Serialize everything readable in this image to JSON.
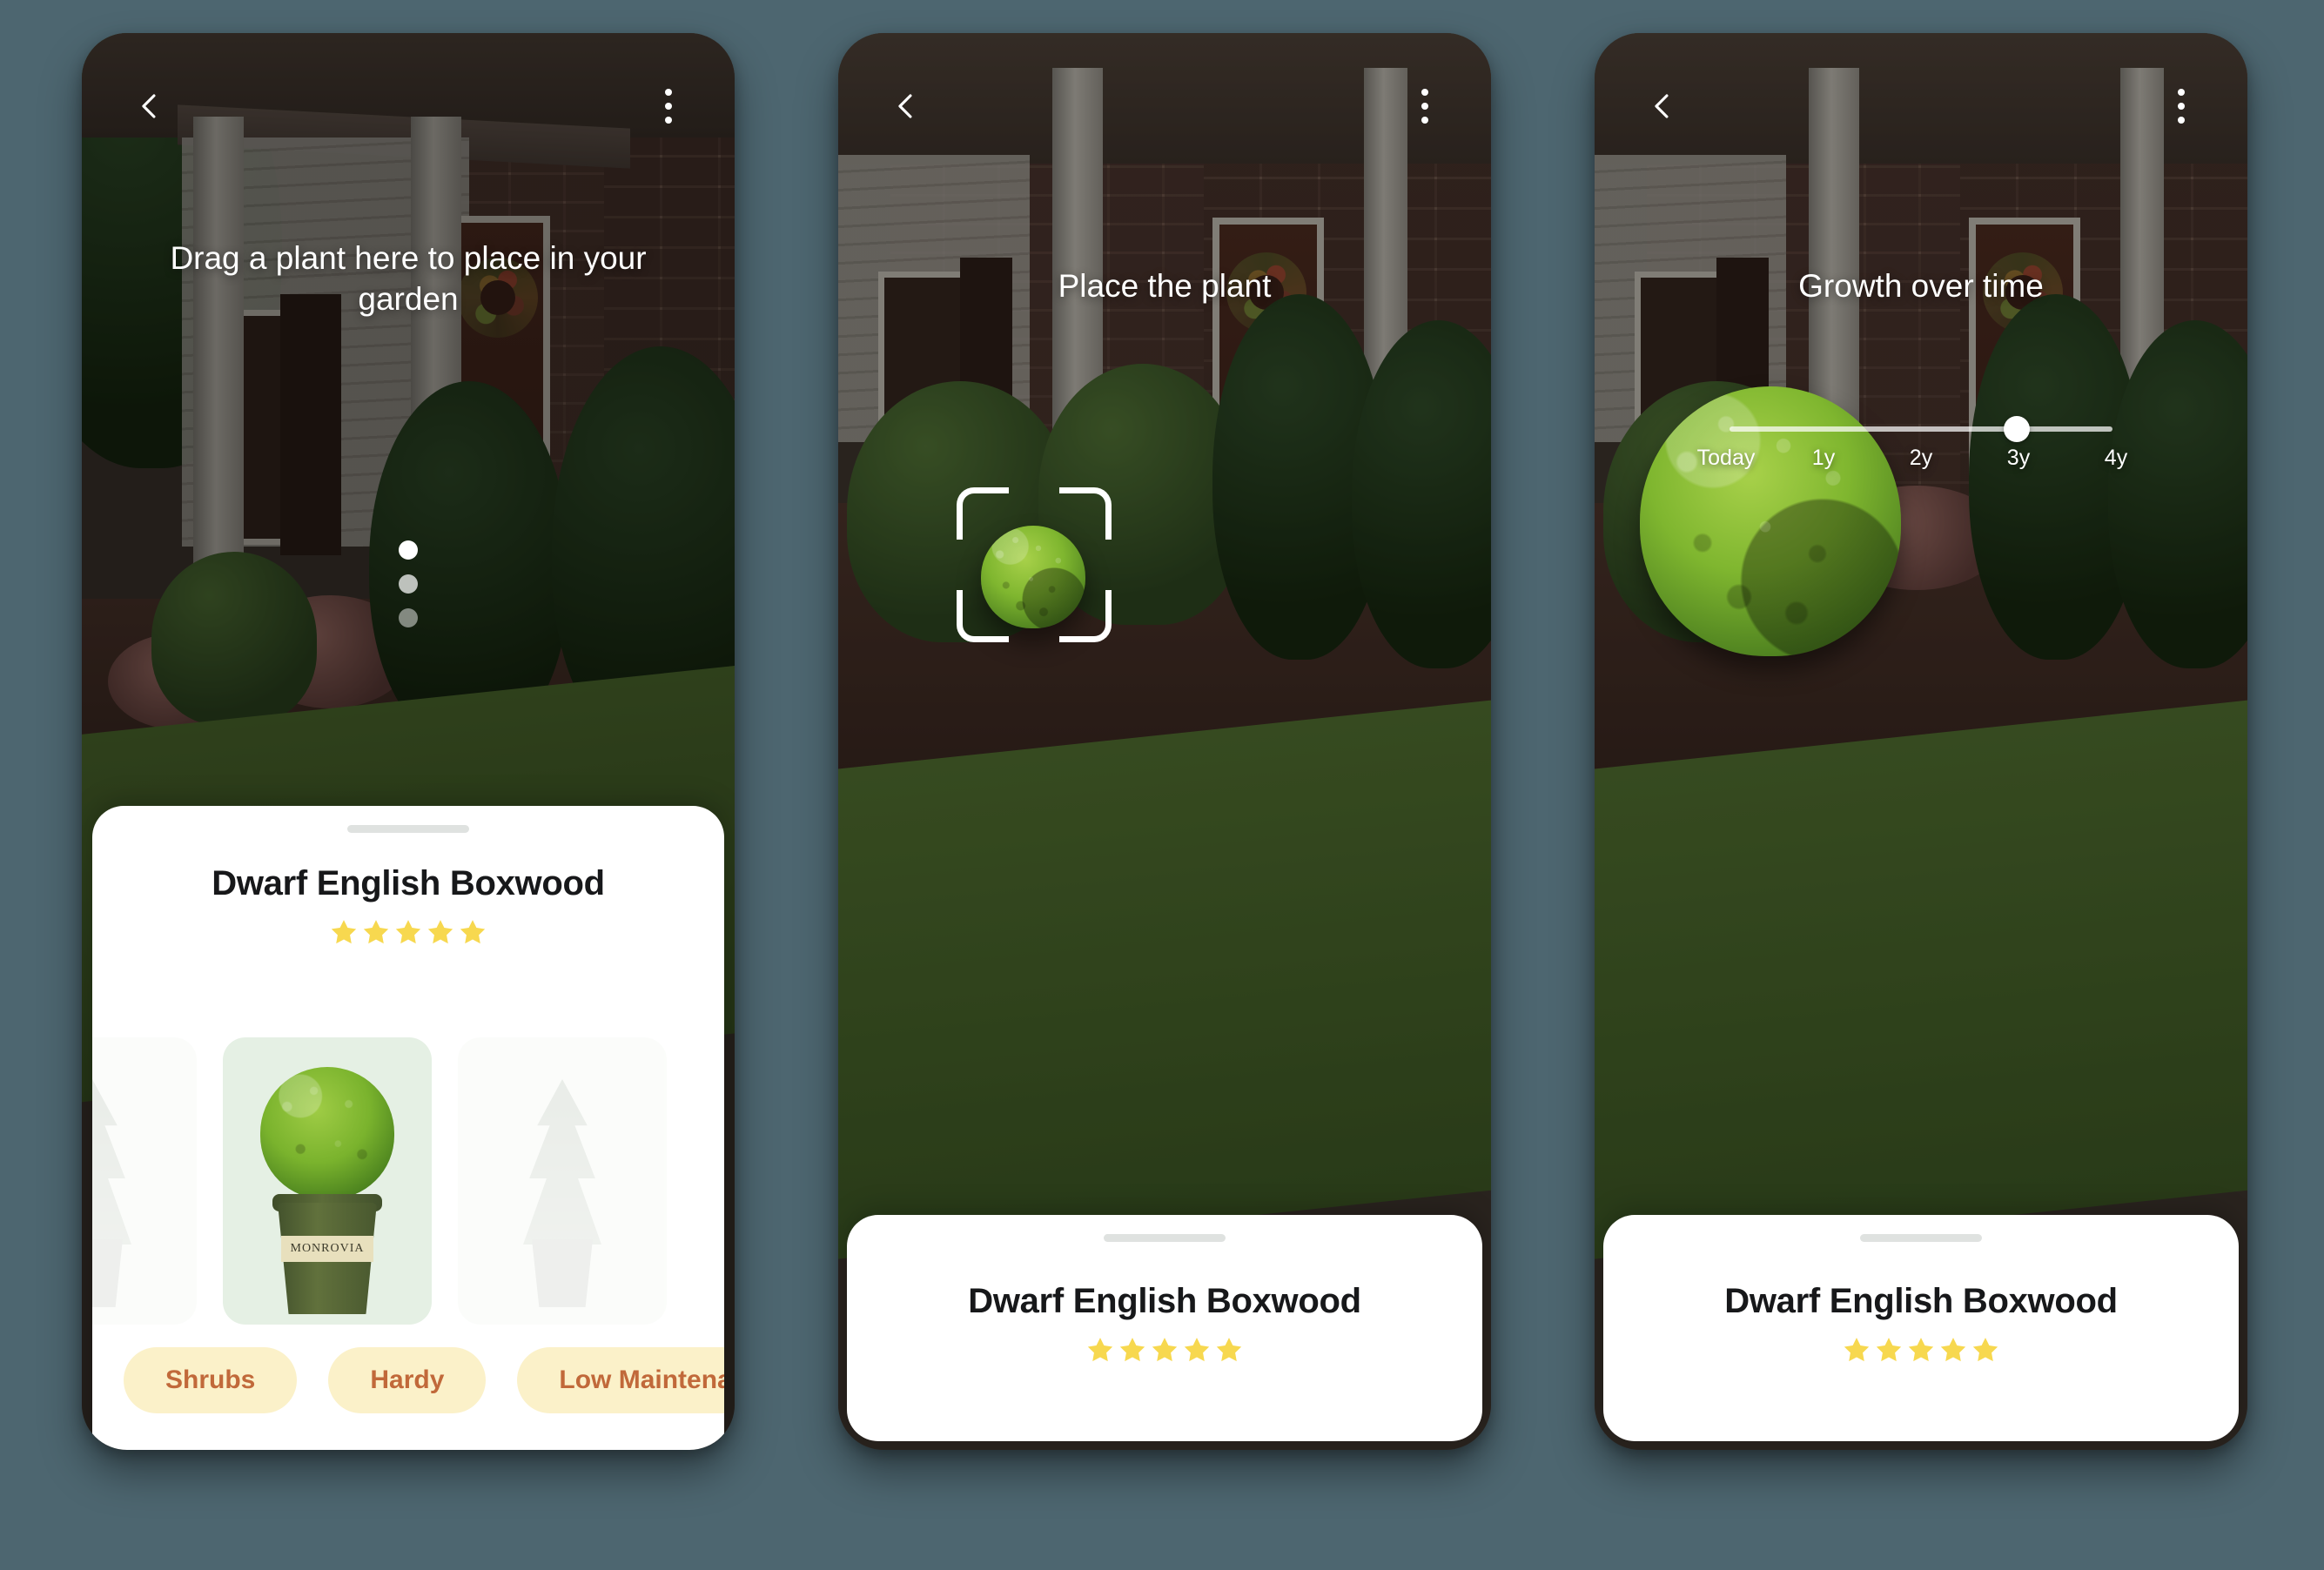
{
  "background_color": "#4d6670",
  "accent": {
    "star_color": "#f7d84f",
    "tag_bg": "#fbf1c9",
    "tag_text": "#c1693a",
    "tile_bg": "#eef5ec",
    "tile_active_bg": "#e5f0e4",
    "sheet_bg": "#ffffff"
  },
  "screens": [
    {
      "id": "drag-to-place",
      "topbar": {
        "back_icon": "chevron-left-icon",
        "more_icon": "more-vertical-icon"
      },
      "hint": "Drag a plant here to place in your garden",
      "page_dots": {
        "count": 3,
        "active_index": 0
      },
      "sheet": {
        "grabber": "drag-handle",
        "title": "Dwarf English Boxwood",
        "rating": 5,
        "rating_max": 5,
        "carousel": [
          {
            "label": "conifer",
            "kind": "conifer",
            "state": "previous"
          },
          {
            "label": "Dwarf English Boxwood",
            "kind": "potted",
            "state": "active",
            "pot_brand": "MONROVIA"
          },
          {
            "label": "conifer",
            "kind": "conifer",
            "state": "next"
          }
        ],
        "tags": [
          "Shrubs",
          "Hardy",
          "Low Maintenance"
        ]
      }
    },
    {
      "id": "place-the-plant",
      "topbar": {
        "back_icon": "chevron-left-icon",
        "more_icon": "more-vertical-icon"
      },
      "hint": "Place the plant",
      "reticle": "ar-target-reticle",
      "sheet": {
        "grabber": "drag-handle",
        "title": "Dwarf English Boxwood",
        "rating": 5,
        "rating_max": 5
      }
    },
    {
      "id": "growth-over-time",
      "topbar": {
        "back_icon": "chevron-left-icon",
        "more_icon": "more-vertical-icon"
      },
      "hint": "Growth over time",
      "slider": {
        "labels": [
          "Today",
          "1y",
          "2y",
          "3y",
          "4y"
        ],
        "selected_label": "3y",
        "selected_index": 3,
        "position_percent": 75
      },
      "sheet": {
        "grabber": "drag-handle",
        "title": "Dwarf English Boxwood",
        "rating": 5,
        "rating_max": 5
      }
    }
  ]
}
